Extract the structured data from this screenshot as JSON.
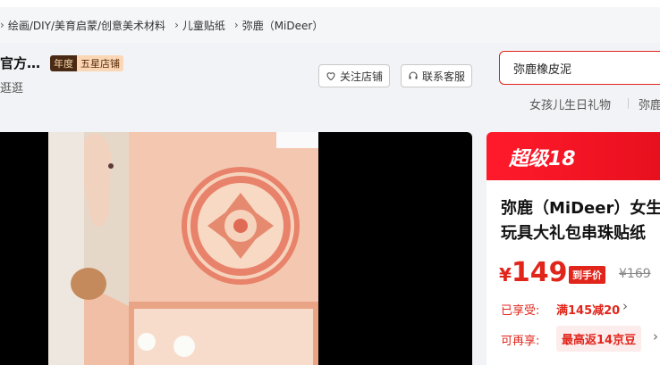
{
  "breadcrumb": {
    "items": [
      "绘画/DIY/美育启蒙/创意美术材料",
      "儿童贴纸",
      "弥鹿（MiDeer）"
    ]
  },
  "shop": {
    "name": "官方…",
    "badge_year": "年度",
    "badge_rank": "五星店铺",
    "visit": "逛逛",
    "follow_label": "关注店铺",
    "service_label": "联系客服"
  },
  "search": {
    "value": "弥鹿橡皮泥",
    "hot": [
      "女孩儿生日礼物",
      "弥鹿"
    ]
  },
  "product": {
    "promo_label": "超级18",
    "title_line1": "弥鹿（MiDeer）女生",
    "title_line2": "玩具大礼包串珠贴纸",
    "price_symbol": "¥",
    "price": "149",
    "price_tag": "到手价",
    "original_price": "¥169",
    "enjoyed_label": "已享受:",
    "enjoyed_offer": "满145减20",
    "available_label": "可再享:",
    "available_offer": "最高返14京豆"
  },
  "colors": {
    "accent": "#e1251b",
    "promo_bg": "#ff1a2b"
  }
}
